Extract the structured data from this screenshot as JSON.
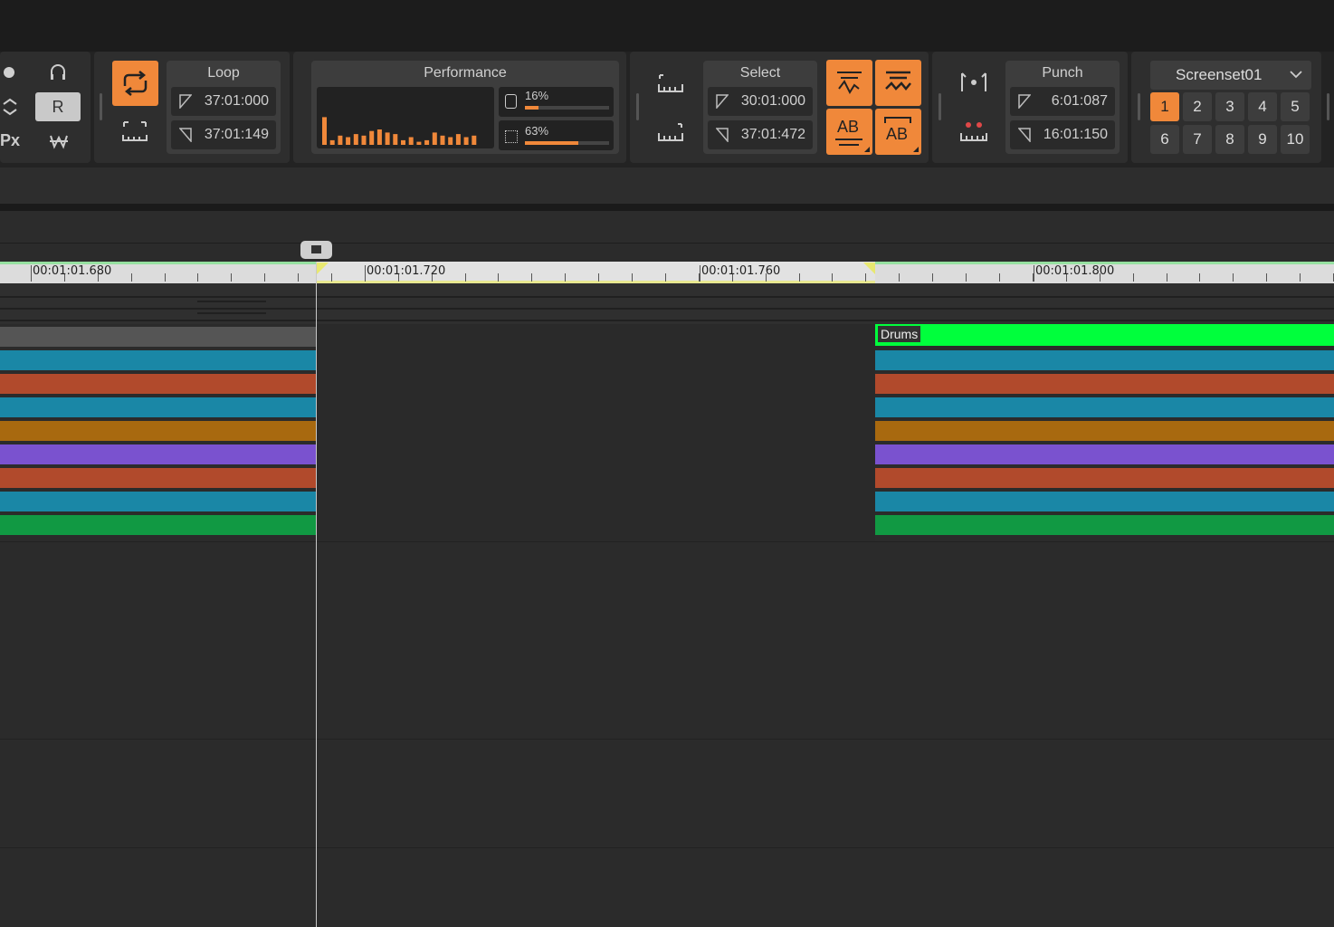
{
  "loop": {
    "title": "Loop",
    "start": "37:01:000",
    "end": "37:01:149"
  },
  "performance": {
    "title": "Performance",
    "disk_label": "16%",
    "disk_value": 0.16,
    "cpu_label": "63%",
    "cpu_value": 0.63,
    "meter_bars": [
      0.9,
      0.15,
      0.3,
      0.25,
      0.35,
      0.3,
      0.45,
      0.5,
      0.4,
      0.35,
      0.15,
      0.25,
      0.1,
      0.15,
      0.4,
      0.3,
      0.25,
      0.35,
      0.25,
      0.3
    ]
  },
  "select": {
    "title": "Select",
    "start": "30:01:000",
    "end": "37:01:472"
  },
  "punch": {
    "title": "Punch",
    "start": "6:01:087",
    "end": "16:01:150"
  },
  "screenset": {
    "name": "Screenset01",
    "buttons": [
      "1",
      "2",
      "3",
      "4",
      "5",
      "6",
      "7",
      "8",
      "9",
      "10"
    ],
    "active": "1"
  },
  "left_tools": {
    "record_label": "R",
    "px_label": "Px"
  },
  "edit_buttons": {
    "ab1": "AB",
    "ab2": "AB"
  },
  "ruler": {
    "labels": [
      "00:01:01.680",
      "00:01:01.720",
      "00:01:01.760",
      "00:01:01.800"
    ]
  },
  "clip": {
    "name": "Drums",
    "color": "#00ff3c"
  },
  "colors": {
    "accent": "#f0883a",
    "blue": "#1a87a6",
    "red": "#b14a2c",
    "orange": "#a8690f",
    "purple": "#7a52cf",
    "green": "#119943",
    "gray": "#555555"
  },
  "tracks": [
    "gray",
    "blue",
    "red",
    "blue",
    "orange",
    "purple",
    "red",
    "blue",
    "green"
  ]
}
